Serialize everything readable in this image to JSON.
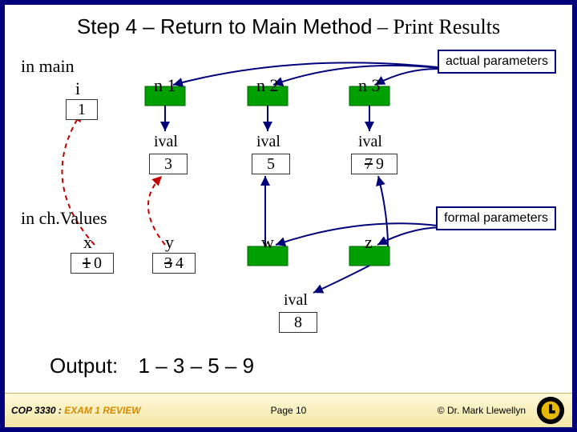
{
  "title": {
    "main": "Step 4 – Return to Main Method",
    "sub": " – Print Results"
  },
  "diagram": {
    "scopes": {
      "main_label": "in main",
      "chvalues_label": "in ch.Values"
    },
    "main": {
      "i": {
        "label": "i",
        "value": "1"
      },
      "n1": {
        "label": "n 1",
        "ival_label": "ival",
        "ival_value": "3"
      },
      "n2": {
        "label": "n 2",
        "ival_label": "ival",
        "ival_value": "5"
      },
      "n3": {
        "label": "n 3",
        "ival_label": "ival",
        "ival_old": "7",
        "ival_new": "9"
      }
    },
    "chvalues": {
      "x": {
        "label": "x",
        "old": "1",
        "new": "0"
      },
      "y": {
        "label": "y",
        "old": "3",
        "new": "4"
      },
      "w": {
        "label": "w"
      },
      "z": {
        "label": "z"
      },
      "new_obj": {
        "ival_label": "ival",
        "ival_value": "8"
      }
    },
    "annotations": {
      "actual_params": "actual parameters",
      "formal_params": "formal parameters"
    }
  },
  "output": {
    "label": "Output:",
    "value": "1 – 3 – 5 – 9"
  },
  "footer": {
    "course": "COP 3330 : ",
    "exam": "EXAM 1 REVIEW",
    "page": "Page 10",
    "copyright": "© Dr. Mark Llewellyn"
  }
}
